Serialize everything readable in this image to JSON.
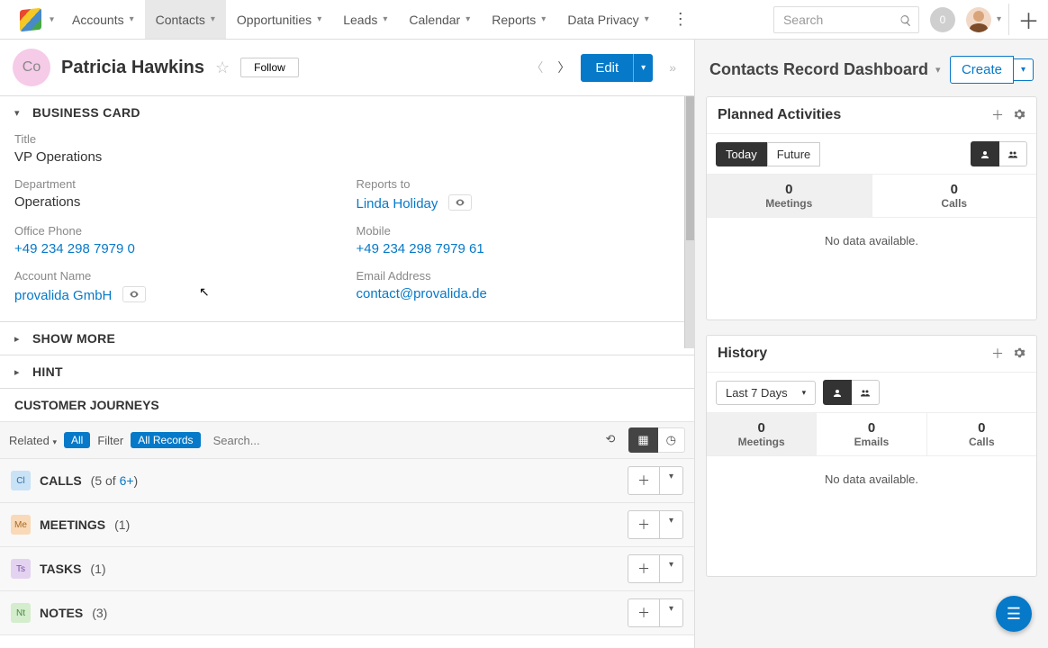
{
  "nav": {
    "items": [
      {
        "label": "Accounts"
      },
      {
        "label": "Contacts"
      },
      {
        "label": "Opportunities"
      },
      {
        "label": "Leads"
      },
      {
        "label": "Calendar"
      },
      {
        "label": "Reports"
      },
      {
        "label": "Data Privacy"
      }
    ],
    "search_placeholder": "Search",
    "notif_count": "0"
  },
  "record": {
    "avatar_initials": "Co",
    "name": "Patricia Hawkins",
    "follow_label": "Follow",
    "edit_label": "Edit"
  },
  "business_card": {
    "title": "BUSINESS CARD",
    "fields": {
      "title_label": "Title",
      "title_value": "VP Operations",
      "department_label": "Department",
      "department_value": "Operations",
      "reports_to_label": "Reports to",
      "reports_to_value": "Linda Holiday",
      "office_phone_label": "Office Phone",
      "office_phone_value": "+49 234 298 7979 0",
      "mobile_label": "Mobile",
      "mobile_value": "+49 234 298 7979 61",
      "account_label": "Account Name",
      "account_value": "provalida GmbH",
      "email_label": "Email Address",
      "email_value": "contact@provalida.de"
    }
  },
  "panels": {
    "show_more": "SHOW MORE",
    "hint": "HINT",
    "customer_journeys": "CUSTOMER JOURNEYS"
  },
  "related": {
    "label": "Related",
    "all_pill": "All",
    "filter_label": "Filter",
    "all_records": "All Records",
    "search_placeholder": "Search...",
    "subpanels": [
      {
        "badge": "Cl",
        "title": "CALLS",
        "count_prefix": "(5 of ",
        "link": "6+",
        "count_suffix": ")",
        "badge_bg": "#c9e2f6",
        "badge_fg": "#2a6da9"
      },
      {
        "badge": "Me",
        "title": "MEETINGS",
        "count": "(1)",
        "badge_bg": "#f9d9b7",
        "badge_fg": "#a56a25"
      },
      {
        "badge": "Ts",
        "title": "TASKS",
        "count": "(1)",
        "badge_bg": "#e3d3f1",
        "badge_fg": "#7a4fa3"
      },
      {
        "badge": "Nt",
        "title": "NOTES",
        "count": "(3)",
        "badge_bg": "#d3edcd",
        "badge_fg": "#4a8a3c"
      }
    ]
  },
  "dashboard": {
    "title": "Contacts Record Dashboard",
    "create_label": "Create",
    "planned": {
      "title": "Planned Activities",
      "today": "Today",
      "future": "Future",
      "stats": [
        {
          "num": "0",
          "label": "Meetings"
        },
        {
          "num": "0",
          "label": "Calls"
        }
      ],
      "no_data": "No data available."
    },
    "history": {
      "title": "History",
      "range": "Last 7 Days",
      "stats": [
        {
          "num": "0",
          "label": "Meetings"
        },
        {
          "num": "0",
          "label": "Emails"
        },
        {
          "num": "0",
          "label": "Calls"
        }
      ],
      "no_data": "No data available."
    }
  }
}
